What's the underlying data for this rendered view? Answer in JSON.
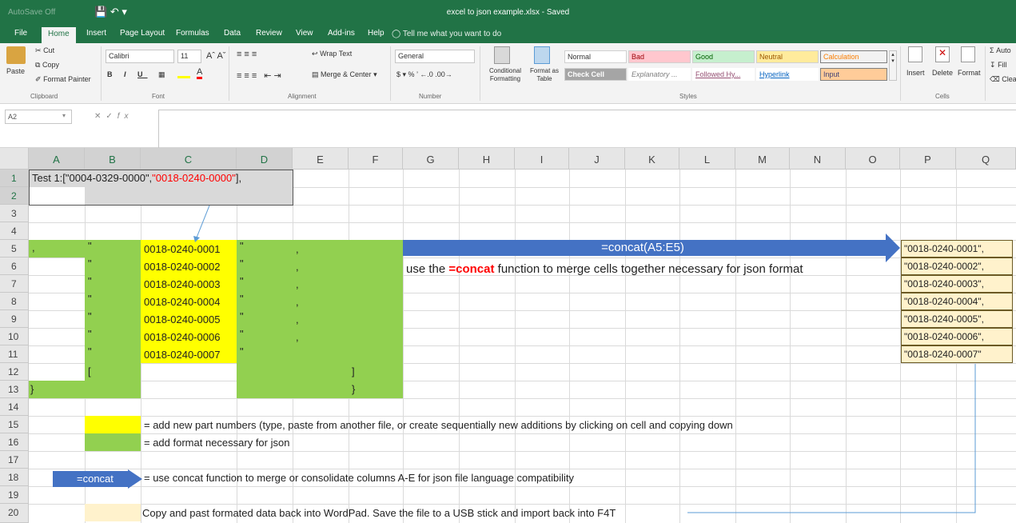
{
  "window": {
    "title": "excel to json example.xlsx - Saved",
    "autosave": "AutoSave Off"
  },
  "tabs": [
    "File",
    "Home",
    "Insert",
    "Page Layout",
    "Formulas",
    "Data",
    "Review",
    "View",
    "Add-ins",
    "Help"
  ],
  "active_tab": "Home",
  "tell_me": "Tell me what you want to do",
  "ribbon": {
    "clipboard": {
      "paste": "Paste",
      "cut": "Cut",
      "copy": "Copy",
      "format_painter": "Format Painter",
      "group": "Clipboard"
    },
    "font": {
      "name": "Calibri",
      "size": "11",
      "group": "Font"
    },
    "alignment": {
      "wrap_text": "Wrap Text",
      "merge_center": "Merge & Center",
      "group": "Alignment"
    },
    "number": {
      "format": "General",
      "group": "Number"
    },
    "styles": {
      "conditional": "Conditional Formatting",
      "format_as_table": "Format as Table",
      "cells": [
        "Normal",
        "Bad",
        "Good",
        "Neutral",
        "Calculation",
        "Check Cell",
        "Explanatory ...",
        "Followed Hy...",
        "Hyperlink",
        "Input"
      ],
      "group": "Styles"
    },
    "cells": {
      "insert": "Insert",
      "delete": "Delete",
      "format": "Format",
      "group": "Cells"
    },
    "editing": {
      "autosum": "Auto",
      "fill": "Fill",
      "clear": "Clea"
    }
  },
  "formula_bar": {
    "name_box": "A2",
    "formula": ""
  },
  "columns": [
    "A",
    "B",
    "C",
    "D",
    "E",
    "F",
    "G",
    "H",
    "I",
    "J",
    "K",
    "L",
    "M",
    "N",
    "O",
    "P",
    "Q"
  ],
  "rows": [
    "1",
    "2",
    "3",
    "4",
    "5",
    "6",
    "7",
    "8",
    "9",
    "10",
    "11",
    "12",
    "13",
    "14",
    "15",
    "16",
    "17",
    "18",
    "19",
    "20"
  ],
  "cells": {
    "a1_black": "Test 1:[\"0004-0329-0000\",",
    "a1_red": "\"0018-0240-0000\"",
    "a1_tail": "],",
    "a5": ",",
    "quote": "\"",
    "comma": ",",
    "part_numbers": [
      "0018-0240-0001",
      "0018-0240-0002",
      "0018-0240-0003",
      "0018-0240-0004",
      "0018-0240-0005",
      "0018-0240-0006",
      "0018-0240-0007"
    ],
    "b12": "[",
    "f12": "]",
    "a13": "}",
    "f13": "}"
  },
  "concat_arrow_label": "=concat(A5:E5)",
  "concat_note": {
    "before": "use the ",
    "keyword": "=concat",
    "after": " function to merge cells together necessary for json format"
  },
  "results": [
    "\"0018-0240-0001\",",
    "\"0018-0240-0002\",",
    "\"0018-0240-0003\",",
    "\"0018-0240-0004\",",
    "\"0018-0240-0005\",",
    "\"0018-0240-0006\",",
    "\"0018-0240-0007\""
  ],
  "legend": {
    "yellow": "= add new part numbers (type, paste from another file, or create sequentially new additions by clicking on cell and copying down",
    "green": "= add format necessary for json",
    "concat_label": "=concat",
    "concat": "= use concat function to merge or consolidate columns A-E for json file language compatibility",
    "copy": "Copy and past formated data back into WordPad.  Save the file to a USB stick and import back into F4T"
  },
  "colors": {
    "excel_green": "#217346",
    "highlight_yellow": "#ffff00",
    "fill_green": "#92d050",
    "arrow_blue": "#4472c4",
    "result_fill": "#fff2cc",
    "keyword_red": "#ff0000"
  }
}
